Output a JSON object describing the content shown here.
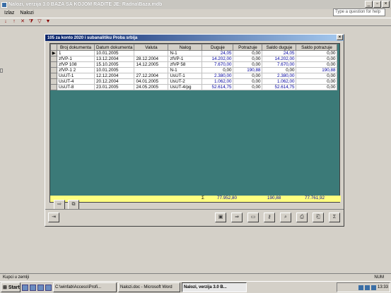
{
  "app": {
    "title": "Nalozi, verzija 3.0    BAZA SA KOJOM RADITE JE: Radna\\Baza.mdb",
    "help_placeholder": "Type a question for help"
  },
  "menu": [
    "Izlaz",
    "Nalozi"
  ],
  "toolbar_icons": [
    "sort-asc-icon",
    "sort-desc-icon",
    "delete-icon",
    "filter-icon",
    "filter-form-icon",
    "apply-filter-icon"
  ],
  "window": {
    "title": "105 za konto 2020 i subanalitiku Proba srbija"
  },
  "table": {
    "headers": [
      "Broj dokumenta",
      "Datum dokumenta",
      "Valuta",
      "Nalog",
      "Duguje",
      "Potrazuje",
      "Saldo duguje",
      "Saldo potrazuje"
    ],
    "rows": [
      [
        "1",
        "10.01.2005",
        "",
        "N-1",
        "24,05",
        "0,00",
        "24,05",
        "0,00"
      ],
      [
        "zfVP-1",
        "13.12.2004",
        "28.12.2004",
        "zfVP-1",
        "14.202,00",
        "0,00",
        "14.202,00",
        "0,00"
      ],
      [
        "zfVP 108",
        "15.10.2005",
        "14.12.2005",
        "zfVP 58",
        "7.670,00",
        "0,00",
        "7.670,00",
        "0,00"
      ],
      [
        "zfVP-1 2",
        "10.01.2005",
        "",
        "N-1",
        "0,00",
        "190,88",
        "0,00",
        "190,88"
      ],
      [
        "UsUT-1",
        "12.12.2004",
        "27.12.2004",
        "UsUT-1",
        "2.380,00",
        "0,00",
        "2.380,00",
        "0,00"
      ],
      [
        "UsUT-4",
        "20.12.2004",
        "04.01.2005",
        "UsUT-2",
        "1.062,00",
        "0,00",
        "1.062,00",
        "0,00"
      ],
      [
        "UsUT-8",
        "23.01.2005",
        "24.05.2005",
        "UsUT-4/pg",
        "52.614,75",
        "0,00",
        "52.614,75",
        "0,00"
      ]
    ],
    "selected_row": 0
  },
  "totals": {
    "sigma": "Σ",
    "duguje": "77.952,80",
    "potrazuje": "190,88",
    "saldo": "77.761,92"
  },
  "status": {
    "text": "Kupci u zemlji",
    "num": "NUM"
  },
  "taskbar": {
    "start": "Start",
    "tasks": [
      "C:\\winfab\\Access\\Profi...",
      "Nalozi.doc - Microsoft Word",
      "Nalozi, verzija 3.0    B..."
    ],
    "clock": "13:33"
  }
}
